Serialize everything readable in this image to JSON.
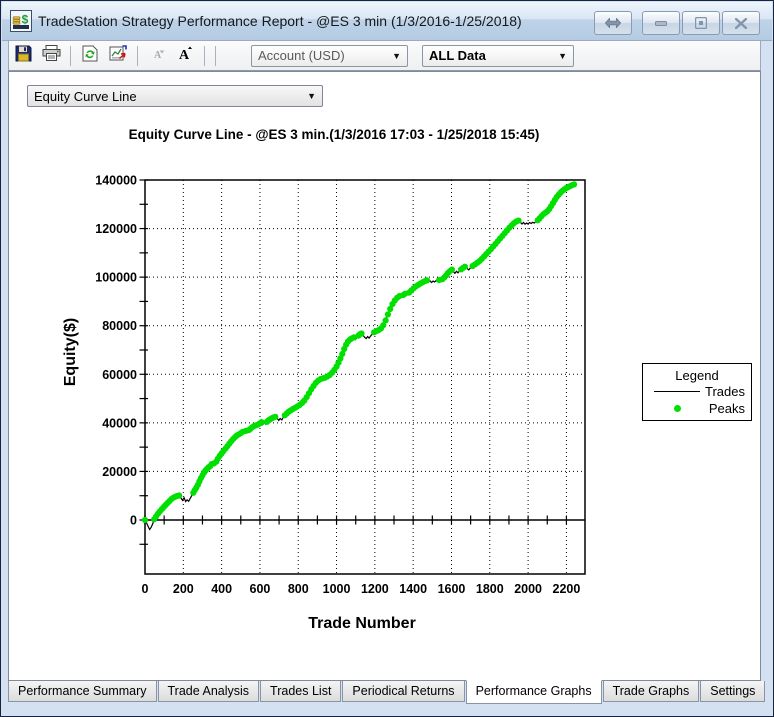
{
  "window": {
    "title": "TradeStation Strategy Performance Report - @ES 3 min (1/3/2016-1/25/2018)",
    "app_icon": "tradestation-report-icon",
    "controls": [
      {
        "name": "dock-toggle-button",
        "icon": "double-arrow-icon",
        "glyph": "⇔"
      },
      {
        "name": "minimize-button",
        "icon": "minimize-icon",
        "glyph": "–"
      },
      {
        "name": "maximize-button",
        "icon": "maximize-icon",
        "glyph": "▣"
      },
      {
        "name": "close-button",
        "icon": "close-icon",
        "glyph": "✕"
      }
    ]
  },
  "toolbar": {
    "items": [
      {
        "type": "button",
        "name": "save-button",
        "icon": "save-icon",
        "disabled": false
      },
      {
        "type": "button",
        "name": "print-button",
        "icon": "print-icon",
        "disabled": false
      },
      {
        "type": "separator"
      },
      {
        "type": "button",
        "name": "refresh-button",
        "icon": "refresh-icon",
        "disabled": false
      },
      {
        "type": "button",
        "name": "report-settings-button",
        "icon": "report-settings-icon",
        "disabled": false
      },
      {
        "type": "separator"
      },
      {
        "type": "button",
        "name": "font-decrease-button",
        "icon": "font-decrease-icon",
        "disabled": true
      },
      {
        "type": "button",
        "name": "font-increase-button",
        "icon": "font-increase-icon",
        "disabled": false
      },
      {
        "type": "separator"
      },
      {
        "type": "separator"
      }
    ],
    "account_dropdown": {
      "value": "Account (USD)"
    },
    "range_dropdown": {
      "value": "ALL Data"
    }
  },
  "report": {
    "graph_selector": {
      "value": "Equity Curve Line"
    }
  },
  "chart_data": {
    "type": "line",
    "title": "Equity Curve Line - @ES 3 min.(1/3/2016 17:03 - 1/25/2018 15:45)",
    "xlabel": "Trade Number",
    "ylabel": "Equity($)",
    "xlim": [
      0,
      2297
    ],
    "ylim": [
      -22200,
      140000
    ],
    "x_ticks": [
      0,
      200,
      400,
      600,
      800,
      1000,
      1200,
      1400,
      1600,
      1800,
      2000,
      2200
    ],
    "x_minor_step": 100,
    "y_ticks": [
      0,
      20000,
      40000,
      60000,
      80000,
      100000,
      120000,
      140000
    ],
    "y_minor_step": 10000,
    "grid": "dotted",
    "legend": {
      "title": "Legend",
      "position": "right",
      "entries": [
        {
          "label": "Trades",
          "marker": "line",
          "color": "#000000"
        },
        {
          "label": "Peaks",
          "marker": "dot",
          "color": "#00e000"
        }
      ]
    },
    "series": [
      {
        "name": "Trades",
        "color": "#000000",
        "points": [
          [
            0,
            0
          ],
          [
            8,
            -1200
          ],
          [
            16,
            -2600
          ],
          [
            24,
            -3900
          ],
          [
            32,
            -3100
          ],
          [
            40,
            -1600
          ],
          [
            48,
            300
          ],
          [
            58,
            1500
          ],
          [
            68,
            2600
          ],
          [
            78,
            3600
          ],
          [
            88,
            4500
          ],
          [
            98,
            5400
          ],
          [
            108,
            6200
          ],
          [
            118,
            7000
          ],
          [
            128,
            7800
          ],
          [
            138,
            8600
          ],
          [
            148,
            9200
          ],
          [
            158,
            9600
          ],
          [
            168,
            9900
          ],
          [
            178,
            10100
          ],
          [
            188,
            9100
          ],
          [
            196,
            8100
          ],
          [
            204,
            9200
          ],
          [
            212,
            7600
          ],
          [
            220,
            8300
          ],
          [
            228,
            7700
          ],
          [
            236,
            8900
          ],
          [
            244,
            10000
          ],
          [
            252,
            11200
          ],
          [
            260,
            12300
          ],
          [
            268,
            13300
          ],
          [
            276,
            14500
          ],
          [
            284,
            15900
          ],
          [
            292,
            17200
          ],
          [
            300,
            18400
          ],
          [
            308,
            19500
          ],
          [
            316,
            20400
          ],
          [
            324,
            21100
          ],
          [
            332,
            21700
          ],
          [
            340,
            22100
          ],
          [
            348,
            23000
          ],
          [
            354,
            22400
          ],
          [
            360,
            23300
          ],
          [
            366,
            22800
          ],
          [
            372,
            24000
          ],
          [
            380,
            25200
          ],
          [
            390,
            26400
          ],
          [
            400,
            27400
          ],
          [
            410,
            28400
          ],
          [
            420,
            29400
          ],
          [
            430,
            30400
          ],
          [
            440,
            31400
          ],
          [
            450,
            32400
          ],
          [
            460,
            33300
          ],
          [
            470,
            34100
          ],
          [
            480,
            34800
          ],
          [
            490,
            35300
          ],
          [
            500,
            35800
          ],
          [
            510,
            36300
          ],
          [
            518,
            36000
          ],
          [
            526,
            36700
          ],
          [
            534,
            36300
          ],
          [
            542,
            37000
          ],
          [
            550,
            37500
          ],
          [
            560,
            38200
          ],
          [
            570,
            38700
          ],
          [
            580,
            39000
          ],
          [
            590,
            39300
          ],
          [
            600,
            39800
          ],
          [
            608,
            40300
          ],
          [
            615,
            39300
          ],
          [
            622,
            40100
          ],
          [
            629,
            39500
          ],
          [
            636,
            40400
          ],
          [
            644,
            41000
          ],
          [
            652,
            41400
          ],
          [
            660,
            41800
          ],
          [
            670,
            42200
          ],
          [
            680,
            42500
          ],
          [
            690,
            42000
          ],
          [
            698,
            41000
          ],
          [
            706,
            41800
          ],
          [
            714,
            41200
          ],
          [
            722,
            42300
          ],
          [
            730,
            43100
          ],
          [
            740,
            43900
          ],
          [
            750,
            44600
          ],
          [
            760,
            45100
          ],
          [
            772,
            45700
          ],
          [
            784,
            46200
          ],
          [
            796,
            46800
          ],
          [
            808,
            47400
          ],
          [
            820,
            48200
          ],
          [
            832,
            49200
          ],
          [
            844,
            50600
          ],
          [
            856,
            52200
          ],
          [
            868,
            53800
          ],
          [
            880,
            55200
          ],
          [
            892,
            56500
          ],
          [
            904,
            57400
          ],
          [
            916,
            58000
          ],
          [
            928,
            58300
          ],
          [
            940,
            58600
          ],
          [
            952,
            59100
          ],
          [
            964,
            59700
          ],
          [
            976,
            60600
          ],
          [
            988,
            61800
          ],
          [
            1000,
            63200
          ],
          [
            1010,
            64800
          ],
          [
            1020,
            66500
          ],
          [
            1030,
            68400
          ],
          [
            1040,
            70400
          ],
          [
            1050,
            72200
          ],
          [
            1060,
            73500
          ],
          [
            1070,
            74300
          ],
          [
            1080,
            74800
          ],
          [
            1090,
            75200
          ],
          [
            1098,
            74300
          ],
          [
            1106,
            75000
          ],
          [
            1114,
            75900
          ],
          [
            1122,
            76500
          ],
          [
            1130,
            76800
          ],
          [
            1138,
            76100
          ],
          [
            1146,
            75300
          ],
          [
            1154,
            74700
          ],
          [
            1162,
            75500
          ],
          [
            1170,
            74900
          ],
          [
            1178,
            75800
          ],
          [
            1186,
            76600
          ],
          [
            1196,
            77300
          ],
          [
            1208,
            77800
          ],
          [
            1220,
            78200
          ],
          [
            1232,
            78900
          ],
          [
            1244,
            80200
          ],
          [
            1256,
            82200
          ],
          [
            1268,
            84600
          ],
          [
            1280,
            86900
          ],
          [
            1292,
            88900
          ],
          [
            1304,
            90400
          ],
          [
            1316,
            91500
          ],
          [
            1328,
            92200
          ],
          [
            1338,
            91700
          ],
          [
            1348,
            92600
          ],
          [
            1358,
            93200
          ],
          [
            1368,
            92800
          ],
          [
            1378,
            93600
          ],
          [
            1390,
            94500
          ],
          [
            1402,
            95400
          ],
          [
            1414,
            96200
          ],
          [
            1426,
            96800
          ],
          [
            1438,
            97400
          ],
          [
            1450,
            97900
          ],
          [
            1462,
            98400
          ],
          [
            1472,
            98700
          ],
          [
            1480,
            97900
          ],
          [
            1488,
            98500
          ],
          [
            1496,
            97800
          ],
          [
            1504,
            98400
          ],
          [
            1512,
            98000
          ],
          [
            1520,
            98600
          ],
          [
            1528,
            98200
          ],
          [
            1536,
            98800
          ],
          [
            1544,
            98400
          ],
          [
            1552,
            99100
          ],
          [
            1562,
            99800
          ],
          [
            1572,
            100700
          ],
          [
            1582,
            101700
          ],
          [
            1592,
            102500
          ],
          [
            1602,
            103100
          ],
          [
            1610,
            102300
          ],
          [
            1618,
            101600
          ],
          [
            1626,
            102400
          ],
          [
            1634,
            101800
          ],
          [
            1642,
            102600
          ],
          [
            1650,
            103200
          ],
          [
            1660,
            103800
          ],
          [
            1670,
            104300
          ],
          [
            1680,
            103700
          ],
          [
            1690,
            103000
          ],
          [
            1700,
            103900
          ],
          [
            1710,
            104600
          ],
          [
            1722,
            105200
          ],
          [
            1734,
            105900
          ],
          [
            1746,
            106600
          ],
          [
            1758,
            107500
          ],
          [
            1770,
            108500
          ],
          [
            1782,
            109500
          ],
          [
            1794,
            110500
          ],
          [
            1806,
            111500
          ],
          [
            1818,
            112600
          ],
          [
            1830,
            113700
          ],
          [
            1842,
            114800
          ],
          [
            1854,
            115900
          ],
          [
            1866,
            117000
          ],
          [
            1878,
            118100
          ],
          [
            1890,
            119200
          ],
          [
            1902,
            120300
          ],
          [
            1914,
            121300
          ],
          [
            1926,
            122200
          ],
          [
            1938,
            122900
          ],
          [
            1950,
            123300
          ],
          [
            1960,
            122600
          ],
          [
            1968,
            121900
          ],
          [
            1976,
            122500
          ],
          [
            1984,
            121800
          ],
          [
            1992,
            122300
          ],
          [
            2000,
            121900
          ],
          [
            2008,
            122500
          ],
          [
            2016,
            122100
          ],
          [
            2024,
            122600
          ],
          [
            2032,
            122300
          ],
          [
            2040,
            122800
          ],
          [
            2050,
            123400
          ],
          [
            2060,
            124200
          ],
          [
            2070,
            125100
          ],
          [
            2080,
            125900
          ],
          [
            2090,
            126500
          ],
          [
            2100,
            127100
          ],
          [
            2110,
            128000
          ],
          [
            2120,
            129200
          ],
          [
            2130,
            130500
          ],
          [
            2140,
            131800
          ],
          [
            2150,
            133000
          ],
          [
            2160,
            134000
          ],
          [
            2170,
            134900
          ],
          [
            2180,
            135600
          ],
          [
            2190,
            136200
          ],
          [
            2200,
            136700
          ],
          [
            2210,
            137100
          ],
          [
            2220,
            137500
          ],
          [
            2230,
            137900
          ],
          [
            2240,
            138200
          ]
        ]
      },
      {
        "name": "Peaks",
        "color": "#00e000",
        "derived": "points of Trades series that set a new equity high"
      }
    ]
  },
  "tabs": {
    "items": [
      {
        "label": "Performance Summary",
        "active": false
      },
      {
        "label": "Trade Analysis",
        "active": false
      },
      {
        "label": "Trades List",
        "active": false
      },
      {
        "label": "Periodical Returns",
        "active": false
      },
      {
        "label": "Performance Graphs",
        "active": true
      },
      {
        "label": "Trade Graphs",
        "active": false
      },
      {
        "label": "Settings",
        "active": false
      }
    ]
  }
}
